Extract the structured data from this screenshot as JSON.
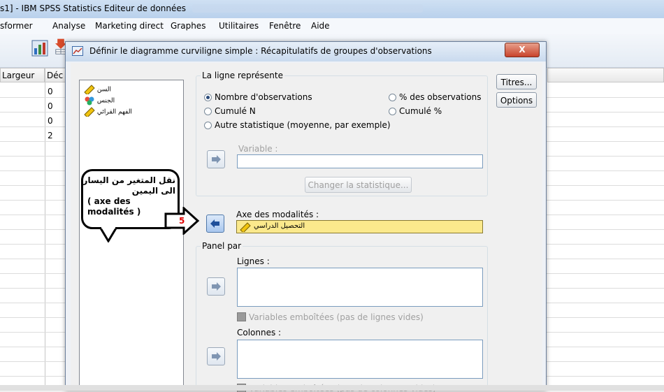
{
  "window": {
    "title": "s1] - IBM SPSS Statistics Editeur de données"
  },
  "menu": {
    "items": [
      "sformer",
      "Analyse",
      "Marketing direct",
      "Graphes",
      "Utilitaires",
      "Fenêtre",
      "Aide"
    ]
  },
  "grid": {
    "headers": [
      "Largeur",
      "Déc"
    ],
    "rows": [
      [
        "0"
      ],
      [
        "0"
      ],
      [
        "0"
      ],
      [
        "2"
      ]
    ]
  },
  "dialog": {
    "title": "Définir le diagramme curviligne simple : Récapitulatifs de groupes d'observations",
    "close_label": "X",
    "variables": [
      {
        "name": "السن",
        "icon": "scale-ruler-icon"
      },
      {
        "name": "الجنس",
        "icon": "nominal-circles-icon"
      },
      {
        "name": "الفهم القرائي",
        "icon": "scale-ruler-icon"
      }
    ],
    "line_group": {
      "legend": "La ligne représente",
      "options": [
        {
          "label": "Nombre d'observations",
          "selected": true
        },
        {
          "label": "% des observations",
          "selected": false
        },
        {
          "label": "Cumulé N",
          "selected": false
        },
        {
          "label": "Cumulé %",
          "selected": false
        },
        {
          "label": "Autre statistique (moyenne, par exemple)",
          "selected": false
        }
      ],
      "variable_label": "Variable :",
      "change_stat_label": "Changer la statistique..."
    },
    "axis": {
      "label": "Axe des modalités :",
      "value": "التحصيل الدراسي"
    },
    "panel": {
      "legend": "Panel par",
      "rows_label": "Lignes :",
      "nested_rows_label": "Variables emboîtées (pas de lignes vides)",
      "cols_label": "Colonnes :",
      "nested_cols_label": "Variables emboîtées (pas de colonnes vides)"
    },
    "side_buttons": {
      "titles": "Titres...",
      "options": "Options"
    }
  },
  "annotation": {
    "lines": [
      "نقل المتغير من اليسار",
      "الى اليمين",
      "( axe des",
      "modalités )"
    ],
    "step": "5"
  },
  "colors": {
    "highlight_field": "#fbe98c",
    "annotation_arrow": "#ffffff",
    "step_number": "#e00000"
  }
}
